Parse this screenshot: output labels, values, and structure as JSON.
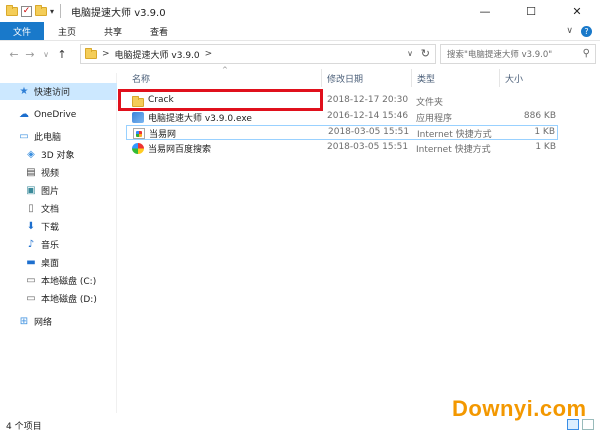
{
  "window": {
    "title": "电脑提速大师 v3.9.0",
    "minimize": "—",
    "maximize": "☐",
    "close": "✕"
  },
  "ribbon": {
    "tabs": [
      "文件",
      "主页",
      "共享",
      "查看"
    ],
    "expand": "∨",
    "help": "?"
  },
  "nav": {
    "back": "←",
    "forward": "→",
    "recent": "∨",
    "up": "↑",
    "path_sep": ">",
    "path": "电脑提速大师 v3.9.0",
    "path_tail": ">",
    "dropdown": "∨",
    "refresh": "↻"
  },
  "search": {
    "placeholder": "搜索\"电脑提速大师 v3.9.0\"",
    "icon": "search-icon"
  },
  "sidebar": {
    "items": [
      {
        "label": "快速访问",
        "icon": "star-icon",
        "selected": true
      },
      {
        "label": "OneDrive",
        "icon": "cloud-icon"
      },
      {
        "label": "此电脑",
        "icon": "computer-icon"
      },
      {
        "label": "3D 对象",
        "icon": "cube-icon"
      },
      {
        "label": "视频",
        "icon": "video-icon"
      },
      {
        "label": "图片",
        "icon": "picture-icon"
      },
      {
        "label": "文档",
        "icon": "document-icon"
      },
      {
        "label": "下载",
        "icon": "download-icon"
      },
      {
        "label": "音乐",
        "icon": "music-icon"
      },
      {
        "label": "桌面",
        "icon": "desktop-icon"
      },
      {
        "label": "本地磁盘 (C:)",
        "icon": "drive-icon"
      },
      {
        "label": "本地磁盘 (D:)",
        "icon": "drive-icon"
      },
      {
        "label": "网络",
        "icon": "network-icon"
      }
    ]
  },
  "columns": {
    "name": "名称",
    "modified": "修改日期",
    "type": "类型",
    "size": "大小",
    "sort_caret": "^"
  },
  "files": [
    {
      "name": "Crack",
      "modified": "2018-12-17 20:30",
      "type": "文件夹",
      "size": "",
      "icon": "folder-icon"
    },
    {
      "name": "电脑提速大师 v3.9.0.exe",
      "modified": "2016-12-14 15:46",
      "type": "应用程序",
      "size": "886 KB",
      "icon": "exe-icon"
    },
    {
      "name": "当易网",
      "modified": "2018-03-05 15:51",
      "type": "Internet 快捷方式",
      "size": "1 KB",
      "icon": "url-shortcut-icon"
    },
    {
      "name": "当易网百度搜索",
      "modified": "2018-03-05 15:51",
      "type": "Internet 快捷方式",
      "size": "1 KB",
      "icon": "url-shortcut-icon"
    }
  ],
  "status": {
    "count": "4 个项目"
  },
  "watermark": "Downyi.com",
  "colors": {
    "accent": "#1979ca",
    "selected_bg": "#cce8ff",
    "highlight_box": "#e0101c",
    "watermark": "#f39800"
  }
}
